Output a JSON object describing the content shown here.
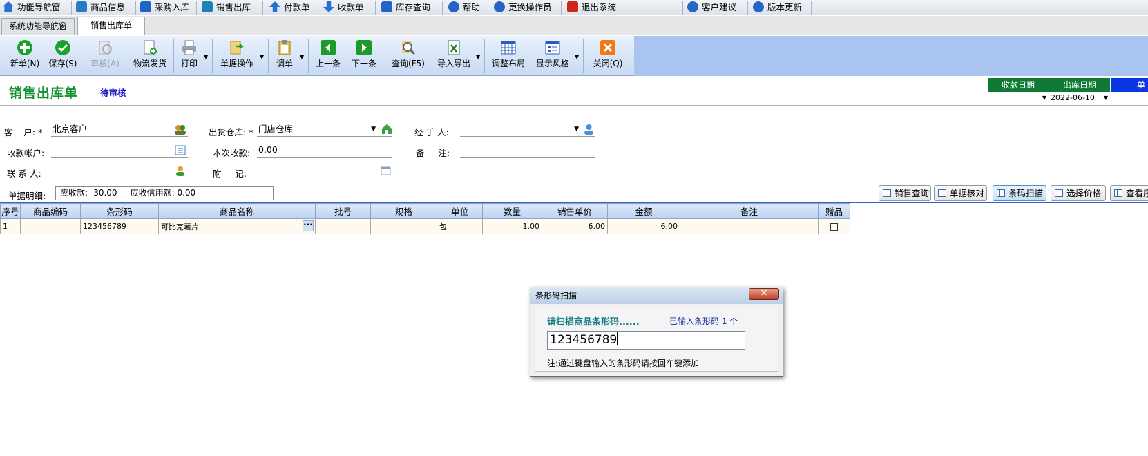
{
  "top_menu": [
    {
      "label": "功能导航窗",
      "icon": "home-icon",
      "color": "#2f6fd0"
    },
    {
      "label": "商品信息",
      "icon": "product-icon",
      "color": "#2a7ac7"
    },
    {
      "label": "采购入库",
      "icon": "purchase-icon",
      "color": "#1f66c2"
    },
    {
      "label": "销售出库",
      "icon": "sales-out-icon",
      "color": "#1d80b8"
    },
    {
      "label": "付款单",
      "icon": "pay-icon",
      "color": "#2a6fd3"
    },
    {
      "label": "收款单",
      "icon": "receive-icon",
      "color": "#2a6fd3"
    },
    {
      "label": "库存查询",
      "icon": "stock-search-icon",
      "color": "#2464c7"
    },
    {
      "label": "帮助",
      "icon": "help-icon",
      "color": "#2364c4"
    },
    {
      "label": "更换操作员",
      "icon": "operator-icon",
      "color": "#2564c4"
    },
    {
      "label": "退出系统",
      "icon": "exit-icon",
      "color": "#d0261e"
    },
    {
      "label": "客户建议",
      "icon": "suggest-icon",
      "color": "#2766c6"
    },
    {
      "label": "版本更新",
      "icon": "update-icon",
      "color": "#2766c6"
    }
  ],
  "tabs": [
    {
      "label": "系统功能导航窗"
    },
    {
      "label": "销售出库单"
    }
  ],
  "toolbar": {
    "new": "新单(N)",
    "save": "保存(S)",
    "audit": "审核(A)",
    "logistics": "物流发货",
    "print": "打印",
    "doc_ops": "单据操作",
    "transfer": "调单",
    "prev": "上一条",
    "next": "下一条",
    "query": "查询(F5)",
    "import_export": "导入导出",
    "layout": "调整布局",
    "style": "显示风格",
    "close": "关闭(Q)"
  },
  "header": {
    "title": "销售出库单",
    "status": "待审核",
    "date_cols": [
      {
        "label": "收款日期",
        "value": ""
      },
      {
        "label": "出库日期",
        "value": "2022-06-10"
      },
      {
        "label": "单",
        "value": ""
      }
    ]
  },
  "form": {
    "customer_label": "客    户: *",
    "customer_value": "北京客户",
    "warehouse_label": "出货仓库: *",
    "warehouse_value": "门店仓库",
    "handler_label": "经 手 人:",
    "handler_value": "",
    "account_label": "收款帐户:",
    "account_value": "",
    "payment_label": "本次收款:",
    "payment_value": "0.00",
    "remark_label": "备     注:",
    "remark_value": "",
    "contact_label": "联 系 人:",
    "contact_value": "",
    "note_label": "附     记:",
    "note_value": ""
  },
  "summary": {
    "label": "单据明细:",
    "text": "应收款: -30.00     应收信用额: 0.00"
  },
  "function_buttons": [
    "销售查询",
    "单据核对",
    "条码扫描",
    "选择价格",
    "查看序"
  ],
  "table": {
    "columns": [
      "序号",
      "商品编码",
      "条形码",
      "商品名称",
      "批号",
      "规格",
      "单位",
      "数量",
      "销售单价",
      "金额",
      "备注",
      "赠品"
    ],
    "rows": [
      {
        "seq": "1",
        "code": "",
        "barcode": "123456789",
        "name": "可比克薯片",
        "batch": "",
        "spec": "",
        "unit": "包",
        "qty": "1.00",
        "price": "6.00",
        "amount": "6.00",
        "remark": ""
      }
    ]
  },
  "dialog": {
    "title": "条形码扫描",
    "prompt": "请扫描商品条形码......",
    "count_text": "已输入条形码 1 个",
    "input_value": "123456789",
    "note": "注:通过键盘输入的条形码请按回车键添加"
  }
}
